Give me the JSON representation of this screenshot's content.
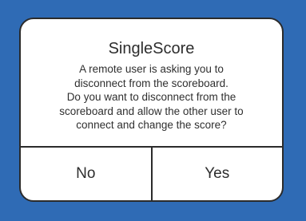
{
  "dialog": {
    "title": "SingleScore",
    "message_lines": [
      "A remote user is asking you to",
      "disconnect from the scoreboard.",
      "Do you want to disconnect from the",
      "scoreboard and allow the other user to",
      "connect and change the score?"
    ],
    "buttons": {
      "no_label": "No",
      "yes_label": "Yes"
    }
  },
  "colors": {
    "background": "#2f6bb5",
    "dialog_background": "#ffffff",
    "border": "#2b2b2b",
    "text": "#2d2d2d"
  }
}
